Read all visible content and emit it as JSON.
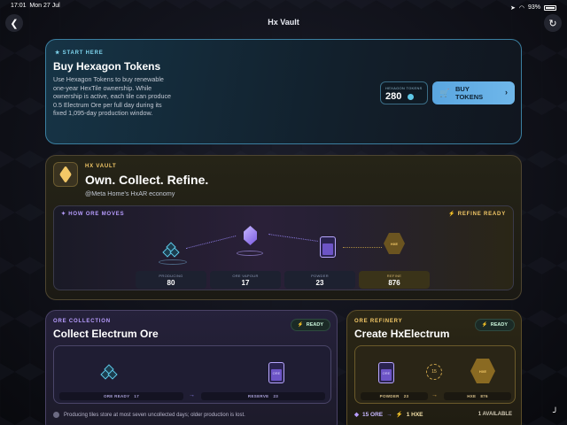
{
  "status": {
    "time": "17:01",
    "date": "Mon 27 Jul",
    "battery": "93%"
  },
  "nav": {
    "title": "Hx Vault",
    "back_icon": "chevron-left-icon",
    "refresh_icon": "refresh-icon"
  },
  "start": {
    "eyebrow": "START HERE",
    "title": "Buy Hexagon Tokens",
    "description": "Use Hexagon Tokens to buy renewable one-year HexTile ownership. While ownership is active, each tile can produce 0.5 Electrum Ore per full day during its fixed 1,095-day production window.",
    "token_label": "HEXAGON TOKENS",
    "token_value": "280",
    "buy_label": "BUY TOKENS"
  },
  "vault": {
    "eyebrow": "HX VAULT",
    "title": "Own. Collect. Refine.",
    "subtitle": "@Meta Home's HxAR economy",
    "flow_label": "HOW ORE MOVES",
    "refine_status": "REFINE READY",
    "hex_label": "HXE",
    "stats": [
      {
        "label": "PRODUCING",
        "value": "80"
      },
      {
        "label": "ORE VAPOUR",
        "value": "17"
      },
      {
        "label": "POWDER",
        "value": "23"
      },
      {
        "label": "REFINE",
        "value": "876"
      }
    ]
  },
  "collection": {
    "eyebrow": "ORE COLLECTION",
    "title": "Collect Electrum Ore",
    "ready": "READY",
    "jar_label": "ORE",
    "ore_ready_label": "ORE READY",
    "ore_ready_value": "17",
    "reserve_label": "RESERVE",
    "reserve_value": "23",
    "footnote": "Producing tiles store at most seven uncollected days; older production is lost."
  },
  "refinery": {
    "eyebrow": "ORE REFINERY",
    "title": "Create HxElectrum",
    "ready": "READY",
    "jar_label": "ORE",
    "ratio_label": "15",
    "hex_label": "HXE",
    "powder_label": "POWDER",
    "powder_value": "23",
    "hxe_label": "HXE",
    "hxe_value": "876",
    "cost": "15 ORE",
    "yield": "1 HXE",
    "available": "1 AVAILABLE"
  },
  "colors": {
    "accent_blue": "#5aa6e0",
    "accent_gold": "#f3c867",
    "accent_purple": "#8e80e8"
  }
}
